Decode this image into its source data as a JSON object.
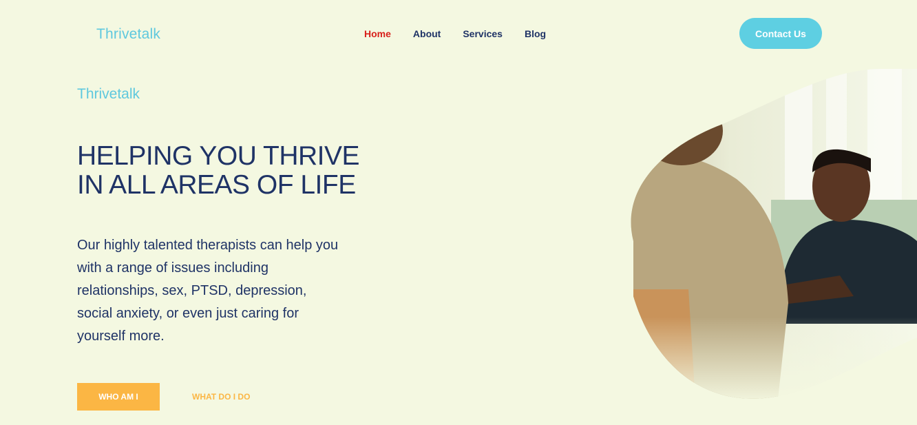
{
  "header": {
    "logo": "Thrivetalk",
    "nav": [
      {
        "label": "Home",
        "active": true
      },
      {
        "label": "About",
        "active": false
      },
      {
        "label": "Services",
        "active": false
      },
      {
        "label": "Blog",
        "active": false
      }
    ],
    "contact_label": "Contact Us"
  },
  "hero": {
    "brand": "Thrivetalk",
    "title_line1": "HELPING YOU THRIVE",
    "title_line2": "IN ALL AREAS OF LIFE",
    "description": "Our highly talented therapists can help you with a range of issues including relationships, sex, PTSD, depression, social anxiety, or even just caring for yourself more.",
    "primary_button": "WHO AM I",
    "secondary_button": "WHAT DO I DO"
  },
  "colors": {
    "background": "#f4f8e1",
    "brand_cyan": "#5ec8de",
    "navy": "#1f3366",
    "active_nav": "#d8211b",
    "accent_orange": "#fbb644"
  }
}
